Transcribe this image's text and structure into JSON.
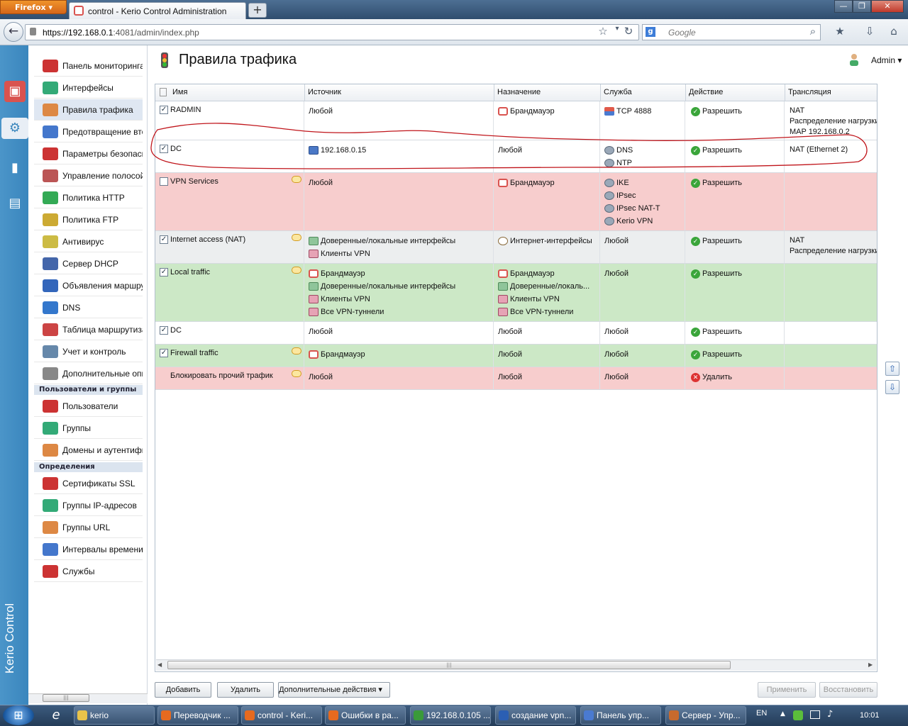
{
  "browser": {
    "app_button": "Firefox",
    "tab_title": "control - Kerio Control Administration",
    "url_host": "https://192.168.0.1",
    "url_rest": ":4081/admin/index.php",
    "search_placeholder": "Google"
  },
  "kerio": {
    "rail_label": "Kerio Control",
    "page_title": "Правила трафика",
    "user": "Admin"
  },
  "sidebar": {
    "items": [
      {
        "label": "Панель мониторинга",
        "icon": "dashboard-icon"
      },
      {
        "label": "Интерфейсы",
        "icon": "network-card-icon"
      },
      {
        "label": "Правила трафика",
        "icon": "traffic-light-icon"
      },
      {
        "label": "Предотвращение вторжений",
        "icon": "shield-icon"
      },
      {
        "label": "Параметры безопасности",
        "icon": "hand-stop-icon"
      },
      {
        "label": "Управление полосой",
        "icon": "bandwidth-icon"
      },
      {
        "label": "Политика HTTP",
        "icon": "globe-check-icon"
      },
      {
        "label": "Политика FTP",
        "icon": "ftp-icon"
      },
      {
        "label": "Антивирус",
        "icon": "antivirus-icon"
      },
      {
        "label": "Сервер DHCP",
        "icon": "dhcp-icon"
      },
      {
        "label": "Объявления маршрутов",
        "icon": "route-broadcast-icon"
      },
      {
        "label": "DNS",
        "icon": "dns-icon"
      },
      {
        "label": "Таблица маршрутизации",
        "icon": "routing-table-icon"
      },
      {
        "label": "Учет и контроль",
        "icon": "accounting-icon"
      },
      {
        "label": "Дополнительные опции",
        "icon": "advanced-options-icon"
      }
    ],
    "section_users": "Пользователи и группы",
    "users_items": [
      {
        "label": "Пользователи",
        "icon": "user-icon"
      },
      {
        "label": "Группы",
        "icon": "group-icon"
      },
      {
        "label": "Домены и аутентификация",
        "icon": "domain-icon"
      }
    ],
    "section_defs": "Определения",
    "defs_items": [
      {
        "label": "Сертификаты SSL",
        "icon": "certificate-icon"
      },
      {
        "label": "Группы IP-адресов",
        "icon": "ip-group-icon"
      },
      {
        "label": "Группы URL",
        "icon": "url-group-icon"
      },
      {
        "label": "Интервалы времени",
        "icon": "time-interval-icon"
      },
      {
        "label": "Службы",
        "icon": "services-icon"
      }
    ]
  },
  "grid": {
    "columns": [
      "Имя",
      "Источник",
      "Назначение",
      "Служба",
      "Действие",
      "Трансляция"
    ],
    "rows": [
      {
        "name": "RADMIN",
        "checked": true,
        "comment": false,
        "color": "white",
        "source": [
          {
            "t": "Любой",
            "i": ""
          }
        ],
        "dest": [
          {
            "t": "Брандмауэр",
            "i": "fw"
          }
        ],
        "service": [
          {
            "t": "TCP 4888",
            "i": "srv"
          }
        ],
        "action": "Разрешить",
        "action_type": "ok",
        "translation": [
          "NAT",
          "Распределение нагрузки",
          "MAP 192.168.0.2"
        ]
      },
      {
        "name": "DC",
        "checked": true,
        "comment": false,
        "color": "white",
        "source": [
          {
            "t": "192.168.0.15",
            "i": "pc"
          }
        ],
        "dest": [
          {
            "t": "Любой",
            "i": ""
          }
        ],
        "service": [
          {
            "t": "DNS",
            "i": "gear"
          },
          {
            "t": "NTP",
            "i": "gear"
          }
        ],
        "action": "Разрешить",
        "action_type": "ok",
        "translation": [
          "NAT (Ethernet 2)"
        ]
      },
      {
        "name": "VPN Services",
        "checked": false,
        "comment": true,
        "color": "red",
        "source": [
          {
            "t": "Любой",
            "i": ""
          }
        ],
        "dest": [
          {
            "t": "Брандмауэр",
            "i": "fw"
          }
        ],
        "service": [
          {
            "t": "IKE",
            "i": "gear"
          },
          {
            "t": "IPsec",
            "i": "gear"
          },
          {
            "t": "IPsec NAT-T",
            "i": "gear"
          },
          {
            "t": "Kerio VPN",
            "i": "gear"
          }
        ],
        "action": "Разрешить",
        "action_type": "ok",
        "translation": []
      },
      {
        "name": "Internet access (NAT)",
        "checked": true,
        "comment": true,
        "color": "gray",
        "source": [
          {
            "t": "Доверенные/локальные интерфейсы",
            "i": "net"
          },
          {
            "t": "Клиенты VPN",
            "i": "vpn"
          }
        ],
        "dest": [
          {
            "t": "Интернет-интерфейсы",
            "i": "inet"
          }
        ],
        "service": [
          {
            "t": "Любой",
            "i": ""
          }
        ],
        "action": "Разрешить",
        "action_type": "ok",
        "translation": [
          "NAT",
          "Распределение нагрузки"
        ]
      },
      {
        "name": "Local traffic",
        "checked": true,
        "comment": true,
        "color": "green",
        "source": [
          {
            "t": "Брандмауэр",
            "i": "fw"
          },
          {
            "t": "Доверенные/локальные интерфейсы",
            "i": "net"
          },
          {
            "t": "Клиенты VPN",
            "i": "vpn"
          },
          {
            "t": "Все VPN-туннели",
            "i": "vpn"
          }
        ],
        "dest": [
          {
            "t": "Брандмауэр",
            "i": "fw"
          },
          {
            "t": "Доверенные/локаль...",
            "i": "net"
          },
          {
            "t": "Клиенты VPN",
            "i": "vpn"
          },
          {
            "t": "Все VPN-туннели",
            "i": "vpn"
          }
        ],
        "service": [
          {
            "t": "Любой",
            "i": ""
          }
        ],
        "action": "Разрешить",
        "action_type": "ok",
        "translation": []
      },
      {
        "name": "DC",
        "checked": true,
        "comment": false,
        "color": "white",
        "source": [
          {
            "t": "Любой",
            "i": ""
          }
        ],
        "dest": [
          {
            "t": "Любой",
            "i": ""
          }
        ],
        "service": [
          {
            "t": "Любой",
            "i": ""
          }
        ],
        "action": "Разрешить",
        "action_type": "ok",
        "translation": []
      },
      {
        "name": "Firewall traffic",
        "checked": true,
        "comment": true,
        "color": "green",
        "source": [
          {
            "t": "Брандмауэр",
            "i": "fw"
          }
        ],
        "dest": [
          {
            "t": "Любой",
            "i": ""
          }
        ],
        "service": [
          {
            "t": "Любой",
            "i": ""
          }
        ],
        "action": "Разрешить",
        "action_type": "ok",
        "translation": []
      },
      {
        "name": "Блокировать прочий трафик",
        "checked": null,
        "comment": true,
        "color": "red",
        "source": [
          {
            "t": "Любой",
            "i": ""
          }
        ],
        "dest": [
          {
            "t": "Любой",
            "i": ""
          }
        ],
        "service": [
          {
            "t": "Любой",
            "i": ""
          }
        ],
        "action": "Удалить",
        "action_type": "del",
        "translation": []
      }
    ]
  },
  "buttons": {
    "add": "Добавить",
    "delete": "Удалить",
    "more": "Дополнительные действия",
    "apply": "Применить",
    "restore": "Восстановить"
  },
  "taskbar": {
    "items": [
      "kerio",
      "Переводчик ...",
      "control - Keri...",
      "Ошибки в ра...",
      "192.168.0.105 ...",
      "создание vpn...",
      "Панель упр...",
      "Сервер - Упр..."
    ],
    "lang": "EN",
    "time": "10:01"
  },
  "colors": {
    "row_red": "#f7cdcd",
    "row_green": "#cce8c6",
    "row_gray": "#eceeef",
    "accent": "#3a86bd"
  }
}
